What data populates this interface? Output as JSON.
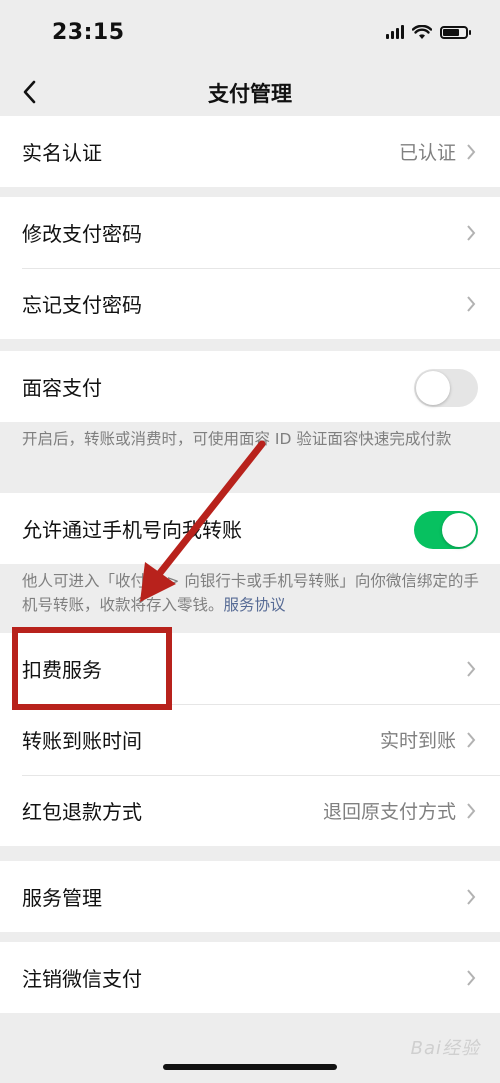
{
  "status_bar": {
    "time": "23:15"
  },
  "nav": {
    "title": "支付管理"
  },
  "rows": {
    "real_name": {
      "label": "实名认证",
      "value": "已认证"
    },
    "change_pwd": {
      "label": "修改支付密码"
    },
    "forgot_pwd": {
      "label": "忘记支付密码"
    },
    "face_pay": {
      "label": "面容支付",
      "toggle": "off"
    },
    "phone_transfer": {
      "label": "允许通过手机号向我转账",
      "toggle": "on"
    },
    "deduction": {
      "label": "扣费服务"
    },
    "arrival_time": {
      "label": "转账到账时间",
      "value": "实时到账"
    },
    "refund": {
      "label": "红包退款方式",
      "value": "退回原支付方式"
    },
    "service_mgmt": {
      "label": "服务管理"
    },
    "cancel_pay": {
      "label": "注销微信支付"
    }
  },
  "notes": {
    "face_pay": "开启后，转账或消费时，可使用面容 ID 验证面容快速完成付款",
    "phone_transfer_text": "他人可进入「收付款 > 向银行卡或手机号转账」向你微信绑定的手机号转账，收款将存入零钱。",
    "phone_transfer_link": "服务协议"
  },
  "watermark": "Bai经验",
  "colors": {
    "accent_green": "#07c160",
    "annotation_red": "#b8221c",
    "link_blue": "#576b95"
  }
}
